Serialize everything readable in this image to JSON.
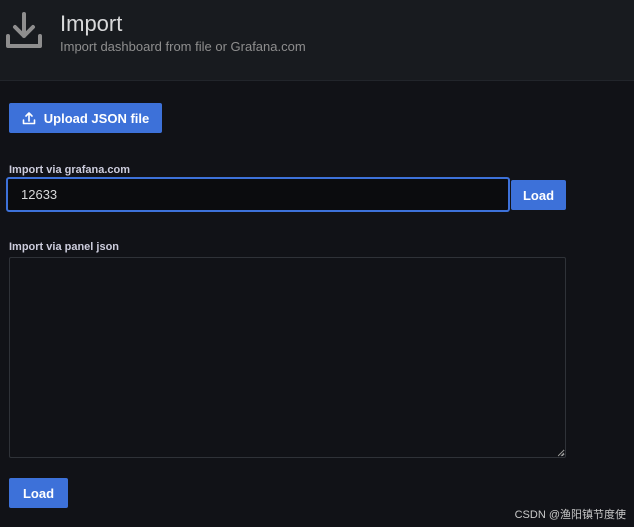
{
  "header": {
    "title": "Import",
    "subtitle": "Import dashboard from file or Grafana.com",
    "icon": "download-icon"
  },
  "upload": {
    "label": "Upload JSON file",
    "icon": "upload-icon"
  },
  "grafana_import": {
    "label": "Import via grafana.com",
    "value": "12633",
    "load_label": "Load"
  },
  "json_import": {
    "label": "Import via panel json",
    "value": "",
    "load_label": "Load"
  },
  "watermark": "CSDN @渔阳镇节度使",
  "colors": {
    "primary": "#3d71d9",
    "background": "#111217",
    "header_bg": "#181b1f"
  }
}
